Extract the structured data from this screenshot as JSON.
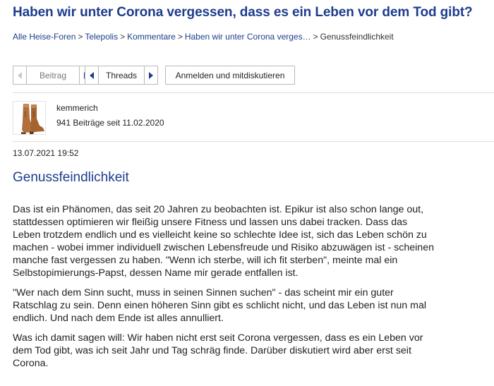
{
  "thread": {
    "title": "Haben wir unter Corona vergessen, dass es ein Leben vor dem Tod gibt?"
  },
  "breadcrumb": {
    "items": [
      "Alle Heise-Foren",
      "Telepolis",
      "Kommentare",
      "Haben wir unter Corona verges…"
    ],
    "current": "Genussfeindlichkeit",
    "separator": ">"
  },
  "toolbar": {
    "post_label": "Beitrag",
    "threads_label": "Threads",
    "login_label": "Anmelden und mitdiskutieren"
  },
  "author": {
    "name": "kemmerich",
    "meta": "941 Beiträge seit 11.02.2020"
  },
  "post": {
    "date": "13.07.2021 19:52",
    "title": "Genussfeindlichkeit",
    "paragraphs": [
      "Das ist ein Phänomen, das seit 20 Jahren zu beobachten ist. Epikur ist also schon lange out, stattdessen optimieren wir fleißig unsere Fitness und lassen uns dabei tracken. Dass das Leben trotzdem endlich und es vielleicht keine so schlechte Idee ist, sich das Leben schön zu machen - wobei immer individuell zwischen Lebensfreude und Risiko abzuwägen ist - scheinen manche fast vergessen zu haben. \"Wenn ich sterbe, will ich fit sterben\", meinte mal ein Selbstopimierungs-Papst, dessen Name mir gerade entfallen ist.",
      "\"Wer nach dem Sinn sucht, muss in seinen Sinnen suchen\" - das scheint mir ein guter Ratschlag zu sein. Denn einen höheren Sinn gibt es schlicht nicht, und das Leben ist nun mal endlich. Und nach dem Ende ist alles annulliert.",
      "Was ich damit sagen will: Wir haben nicht erst seit Corona vergessen, dass es ein Leben vor dem Tod gibt, was ich seit Jahr und Tag schräg finde. Darüber diskutiert wird aber erst seit Corona."
    ]
  },
  "colors": {
    "link_blue": "#1d3c8c",
    "button_border": "#b9b9b9"
  }
}
